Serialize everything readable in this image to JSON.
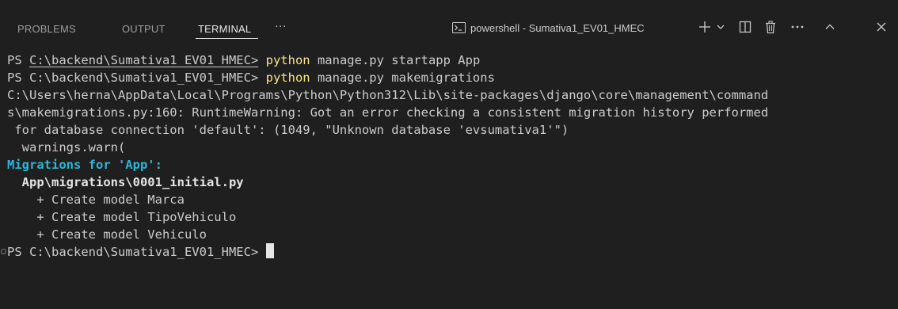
{
  "tabs": [
    {
      "label": "PROBLEMS"
    },
    {
      "label": "OUTPUT"
    },
    {
      "label": "TERMINAL"
    }
  ],
  "more_tabs": "···",
  "terminal_title": "powershell - Sumativa1_EV01_HMEC",
  "header_icons": [
    "terminal-icon",
    "plus-icon",
    "chevron-down-icon",
    "split-icon",
    "trash-icon",
    "ellipsis-icon",
    "chevron-up-icon",
    "close-icon"
  ],
  "colors": {
    "background": "#1f1f1f",
    "text": "#cccccc",
    "command": "#f2e68c",
    "migrations_header": "#29b8db",
    "active_tab_underline": "#e7e7e7"
  },
  "terminal": {
    "line1": {
      "prompt": "PS ",
      "path": "C:\\backend\\Sumativa1_EV01_HMEC>",
      "cmd": "python",
      "args": " manage.py startapp App"
    },
    "line2": {
      "prompt": "PS C:\\backend\\Sumativa1_EV01_HMEC> ",
      "cmd": "python",
      "args": " manage.py makemigrations"
    },
    "line3": "C:\\Users\\herna\\AppData\\Local\\Programs\\Python\\Python312\\Lib\\site-packages\\django\\core\\management\\command",
    "line4": "s\\makemigrations.py:160: RuntimeWarning: Got an error checking a consistent migration history performed",
    "line5": " for database connection 'default': (1049, \"Unknown database 'evsumativa1'\")",
    "line6": "  warnings.warn(",
    "line7": "Migrations for 'App':",
    "line8": "  App\\migrations\\0001_initial.py",
    "line9": "    + Create model Marca",
    "line10": "    + Create model TipoVehiculo",
    "line11": "    + Create model Vehiculo",
    "line12": "PS C:\\backend\\Sumativa1_EV01_HMEC> "
  }
}
